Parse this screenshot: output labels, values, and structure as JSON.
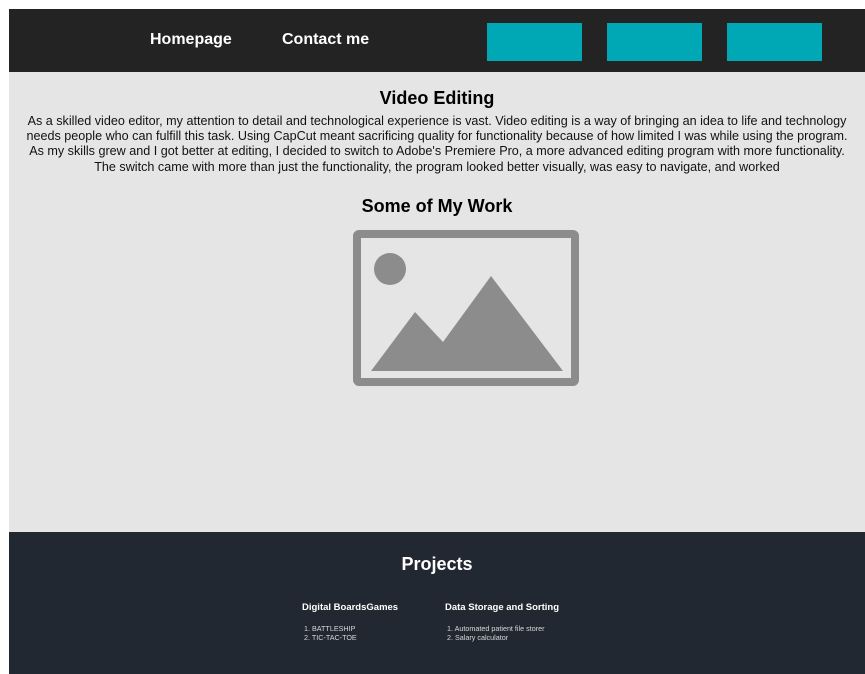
{
  "nav": {
    "links": [
      "Homepage",
      "Contact me"
    ],
    "button_color": "#00a8b5"
  },
  "main": {
    "title": "Video Editing",
    "paragraph": "As a skilled video editor, my attention to detail and technological experience is vast. Video editing is a way of bringing an idea to life and technology needs people who can fulfill this task. Using CapCut meant sacrificing quality for functionality because of how limited I was while using the program. As my skills grew and I got better at editing, I decided to switch to Adobe's Premiere Pro, a more advanced editing program with more functionality. The switch came with more than just the functionality, the program looked better visually, was easy to navigate, and worked",
    "work_title": "Some of My Work"
  },
  "footer": {
    "title": "Projects",
    "columns": [
      {
        "heading": "Digital BoardsGames",
        "items": [
          "1. BATTLESHIP",
          "2. TIC-TAC-TOE"
        ]
      },
      {
        "heading": "Data Storage and Sorting",
        "items": [
          "1. Automated patient file storer",
          "2. Salary calculator"
        ]
      }
    ]
  },
  "colors": {
    "navbar": "#232323",
    "main_bg": "#e5e5e5",
    "footer_bg": "#222831",
    "image_placeholder": "#8c8c8c"
  }
}
